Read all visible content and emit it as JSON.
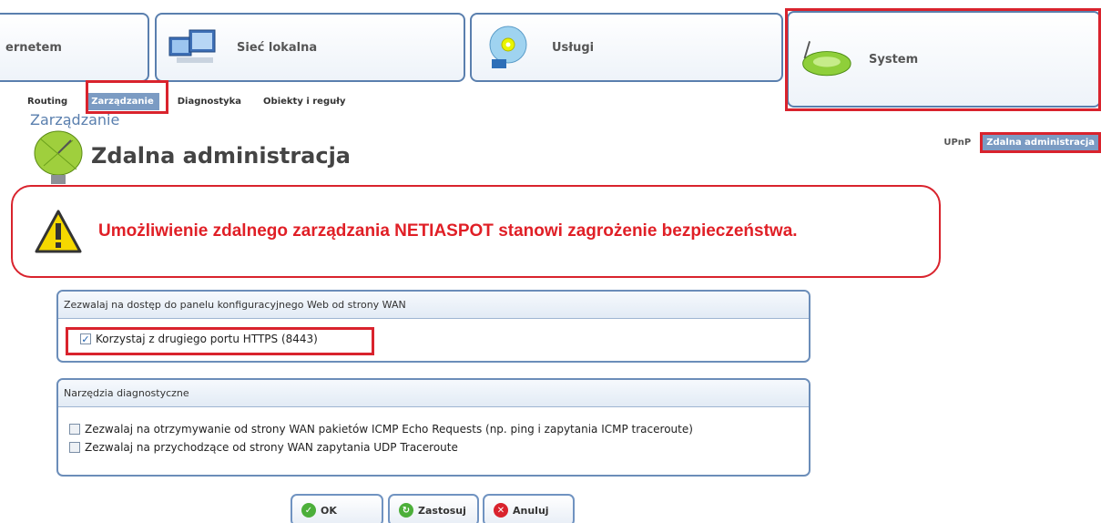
{
  "top_tabs": {
    "internet": "ernetem",
    "local_network": "Sieć lokalna",
    "services": "Usługi",
    "system": "System"
  },
  "subnav": {
    "items": [
      "Routing",
      "Zarządzanie",
      "Diagnostyka",
      "Obiekty i reguły"
    ]
  },
  "breadcrumb": "Zarządzanie",
  "page_title": "Zdalna administracja",
  "right_links": {
    "upnp": "UPnP",
    "active": "Zdalna administracja"
  },
  "warning": {
    "text": "Umożliwienie zdalnego zarządzania NETIASPOT stanowi zagrożenie bezpieczeństwa."
  },
  "panel_wan": {
    "title": "Zezwalaj na dostęp do panelu konfiguracyjnego Web od strony WAN",
    "https_label": "Korzystaj z drugiego portu HTTPS (8443)",
    "https_checked": true
  },
  "panel_diag": {
    "title": "Narzędzia diagnostyczne",
    "icmp_label": "Zezwalaj na otrzymywanie od strony WAN pakietów ICMP Echo Requests (np. ping i zapytania ICMP traceroute)",
    "icmp_checked": false,
    "udp_label": "Zezwalaj na przychodzące od strony WAN zapytania UDP Traceroute",
    "udp_checked": false
  },
  "buttons": {
    "ok": "OK",
    "apply": "Zastosuj",
    "cancel": "Anuluj"
  },
  "colors": {
    "accent": "#7b9bc3",
    "highlight_border": "#d9232d",
    "warning_text": "#e01f26"
  }
}
